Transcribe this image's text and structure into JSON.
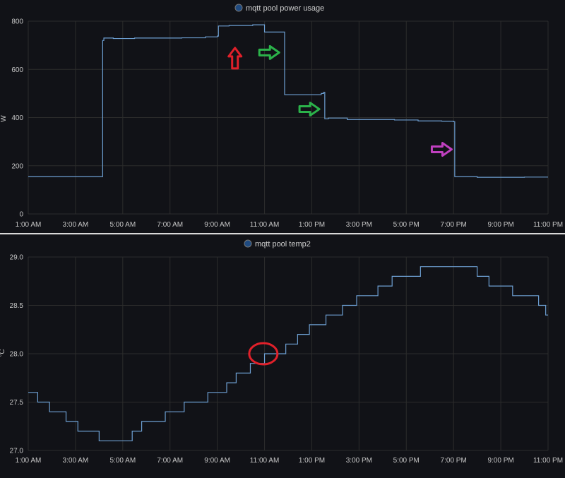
{
  "colors": {
    "background": "#111217",
    "grid": "#2c2c2c",
    "series": "#6d9fd2",
    "separator": "#d9d9d9",
    "arrow_red": "#e0202a",
    "arrow_green": "#2bb34a",
    "arrow_purple": "#c040c0",
    "circle_red": "#e0202a"
  },
  "chart_data": [
    {
      "type": "line",
      "title": "mqtt pool power usage",
      "ylabel": "W",
      "ylim": [
        0,
        800
      ],
      "yticks": [
        0,
        200,
        400,
        600,
        800
      ],
      "xlim": [
        1,
        23
      ],
      "xticks": [
        1,
        3,
        5,
        7,
        9,
        11,
        13,
        15,
        17,
        19,
        21,
        23
      ],
      "xtick_labels": [
        "1:00 AM",
        "3:00 AM",
        "5:00 AM",
        "7:00 AM",
        "9:00 AM",
        "11:00 AM",
        "1:00 PM",
        "3:00 PM",
        "5:00 PM",
        "7:00 PM",
        "9:00 PM",
        "11:00 PM"
      ],
      "series": [
        {
          "x": [
            1,
            4.1,
            4.15,
            4.2,
            4.6,
            5.5,
            6.5,
            7.5,
            8.5,
            9.0,
            9.05,
            9.5,
            10.5,
            10.95,
            11.0,
            11.5,
            11.8,
            11.85,
            12.5,
            13.4,
            13.5,
            13.55,
            13.7,
            14.5,
            15.5,
            16.5,
            17.5,
            18.5,
            19.0,
            19.05,
            20.0,
            21.0,
            22.0,
            23.0
          ],
          "y": [
            155,
            155,
            720,
            730,
            728,
            730,
            730,
            731,
            735,
            738,
            780,
            782,
            785,
            785,
            755,
            755,
            755,
            495,
            495,
            500,
            505,
            395,
            398,
            392,
            392,
            390,
            386,
            385,
            383,
            155,
            152,
            152,
            153,
            153
          ]
        }
      ],
      "annotations": [
        {
          "type": "arrow",
          "direction": "up",
          "color": "red",
          "x": 9.75,
          "y": 645
        },
        {
          "type": "arrow",
          "direction": "right",
          "color": "green",
          "x": 11.2,
          "y": 670
        },
        {
          "type": "arrow",
          "direction": "right",
          "color": "green",
          "x": 12.9,
          "y": 435
        },
        {
          "type": "arrow",
          "direction": "right",
          "color": "purple",
          "x": 18.5,
          "y": 268
        }
      ],
      "grid": true
    },
    {
      "type": "line",
      "title": "mqtt pool temp2",
      "ylabel": "°C",
      "ylim": [
        27.0,
        29.0
      ],
      "yticks": [
        27.0,
        27.5,
        28.0,
        28.5,
        29.0
      ],
      "ytick_labels": [
        "27.0",
        "27.5",
        "28.0",
        "28.5",
        "29.0"
      ],
      "xlim": [
        1,
        23
      ],
      "xticks": [
        1,
        3,
        5,
        7,
        9,
        11,
        13,
        15,
        17,
        19,
        21,
        23
      ],
      "xtick_labels": [
        "1:00 AM",
        "3:00 AM",
        "5:00 AM",
        "7:00 AM",
        "9:00 AM",
        "11:00 AM",
        "1:00 PM",
        "3:00 PM",
        "5:00 PM",
        "7:00 PM",
        "9:00 PM",
        "11:00 PM"
      ],
      "series": [
        {
          "x": [
            1.0,
            1.4,
            1.9,
            2.6,
            3.1,
            4.0,
            4.3,
            5.0,
            5.4,
            5.8,
            6.8,
            7.6,
            8.6,
            9.4,
            9.8,
            10.4,
            11.0,
            11.9,
            12.4,
            12.9,
            13.6,
            14.3,
            14.9,
            15.8,
            16.4,
            17.0,
            17.6,
            18.0,
            18.4,
            19.0,
            19.2,
            20.0,
            20.5,
            21.0,
            21.5,
            22.0,
            22.6,
            22.9,
            23.0
          ],
          "y": [
            27.6,
            27.5,
            27.4,
            27.3,
            27.2,
            27.1,
            27.1,
            27.1,
            27.2,
            27.3,
            27.4,
            27.5,
            27.6,
            27.7,
            27.8,
            27.9,
            28.0,
            28.1,
            28.2,
            28.3,
            28.4,
            28.5,
            28.6,
            28.7,
            28.8,
            28.8,
            28.9,
            28.9,
            28.9,
            28.9,
            28.9,
            28.8,
            28.7,
            28.7,
            28.6,
            28.6,
            28.5,
            28.4,
            28.4
          ]
        }
      ],
      "annotations": [
        {
          "type": "circle",
          "color": "red",
          "x": 10.95,
          "y": 28.0
        }
      ],
      "grid": true
    }
  ]
}
